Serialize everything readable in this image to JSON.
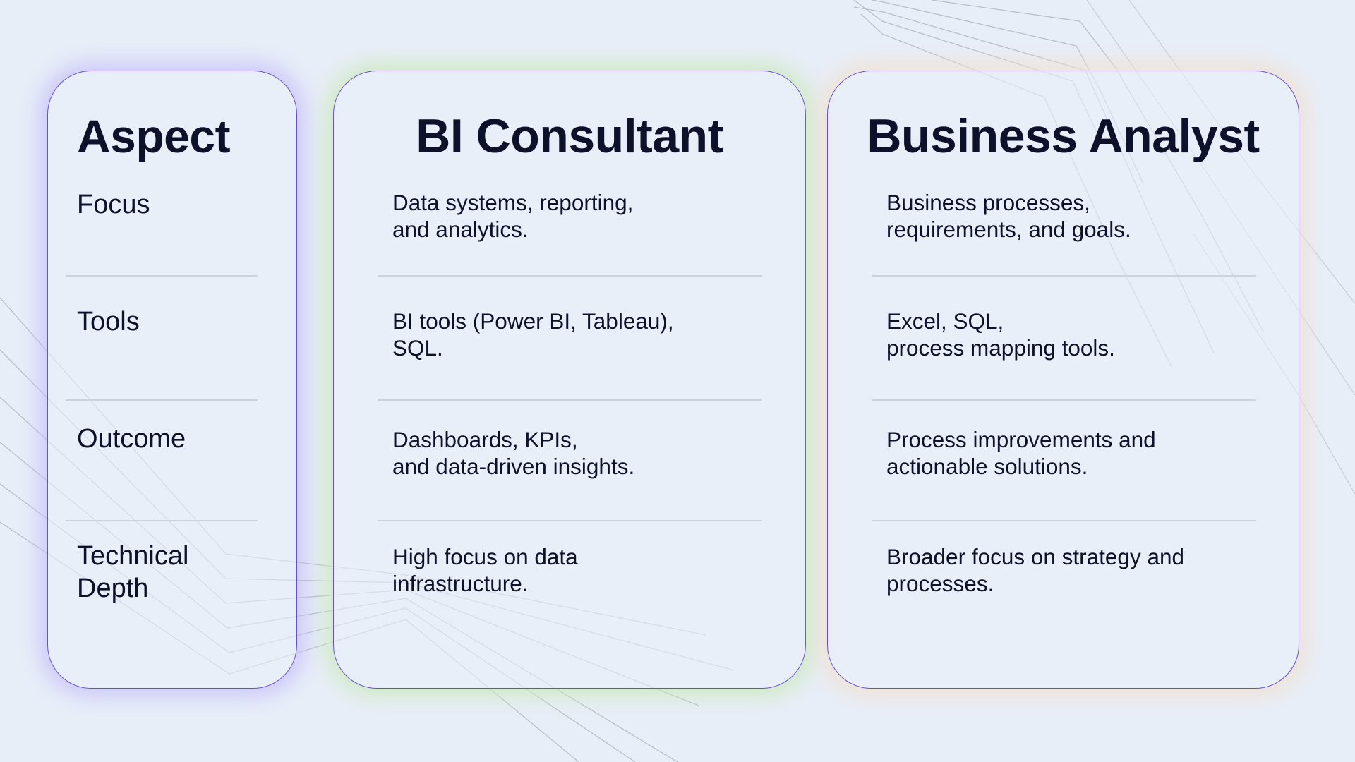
{
  "columns": {
    "aspect": {
      "title": "Aspect",
      "rows": [
        "Focus",
        "Tools",
        "Outcome",
        "Technical\nDepth"
      ]
    },
    "bi_consultant": {
      "title": "BI Consultant",
      "rows": [
        "Data systems, reporting,\nand analytics.",
        "BI tools (Power BI, Tableau),\nSQL.",
        "Dashboards, KPIs,\nand data-driven insights.",
        "High focus on data\ninfrastructure."
      ]
    },
    "business_analyst": {
      "title": "Business Analyst",
      "rows": [
        "Business processes,\nrequirements, and goals.",
        "Excel, SQL,\nprocess mapping tools.",
        "Process improvements and\nactionable solutions.",
        "Broader focus on strategy and\nprocesses."
      ]
    }
  },
  "theme": {
    "background": "#e8eef8",
    "card_border": "#6b4fc8",
    "text": "#0b1229",
    "aspect_glow": "#c4bcfa",
    "bi_glow": "#cde9be",
    "ba_glow": "#f0e0d2"
  }
}
